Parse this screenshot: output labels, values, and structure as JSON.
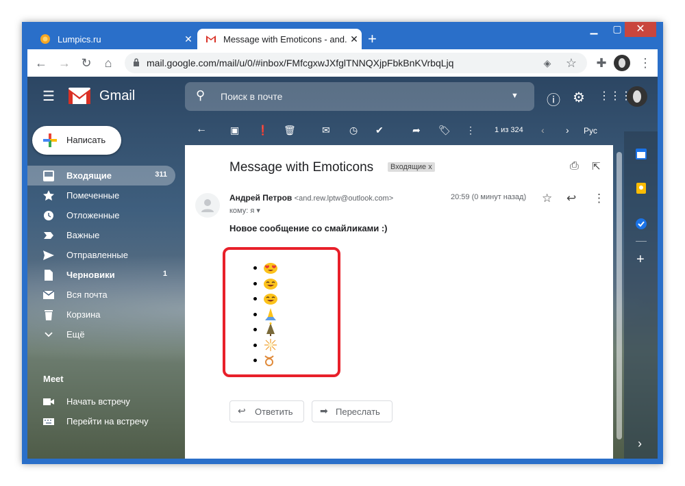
{
  "browser": {
    "tabs": [
      {
        "title": "Lumpics.ru",
        "close": "✕"
      },
      {
        "title": "Message with Emoticons - and.re",
        "close": "✕"
      }
    ],
    "new_tab": "+",
    "url": "mail.google.com/mail/u/0/#inbox/FMfcgxwJXfglTNNQXjpFbkBnKVrbqLjq"
  },
  "gmail": {
    "brand": "Gmail",
    "search_placeholder": "Поиск в почте",
    "compose_label": "Написать",
    "nav": [
      {
        "label": "Входящие",
        "count": "311",
        "icon": "inbox-icon"
      },
      {
        "label": "Помеченные",
        "count": "",
        "icon": "star-icon"
      },
      {
        "label": "Отложенные",
        "count": "",
        "icon": "clock-icon"
      },
      {
        "label": "Важные",
        "count": "",
        "icon": "important-icon"
      },
      {
        "label": "Отправленные",
        "count": "",
        "icon": "send-icon"
      },
      {
        "label": "Черновики",
        "count": "1",
        "icon": "draft-icon"
      },
      {
        "label": "Вся почта",
        "count": "",
        "icon": "mail-icon"
      },
      {
        "label": "Корзина",
        "count": "",
        "icon": "trash-icon"
      },
      {
        "label": "Ещё",
        "count": "",
        "icon": "chevron-down-icon"
      }
    ],
    "meet": {
      "heading": "Meet",
      "items": [
        {
          "label": "Начать встречу",
          "icon": "video-icon"
        },
        {
          "label": "Перейти на встречу",
          "icon": "keyboard-icon"
        }
      ]
    },
    "pager": "1 из 324",
    "lang": "Рус"
  },
  "message": {
    "subject": "Message with Emoticons",
    "label": "Входящие",
    "label_close": "x",
    "sender_name": "Андрей Петров",
    "sender_email": "<and.rew.lptw@outlook.com>",
    "to": "кому: я",
    "time": "20:59 (0 минут назад)",
    "body": "Новое сообщение со смайликами :)",
    "emoticons": [
      "😍",
      "😄",
      "😄",
      "🙏",
      "🎄",
      "💥",
      "♉"
    ],
    "reply_label": "Ответить",
    "forward_label": "Переслать"
  },
  "colors": {
    "red_highlight": "#e8202a",
    "window_blue": "#2a6fc9"
  }
}
